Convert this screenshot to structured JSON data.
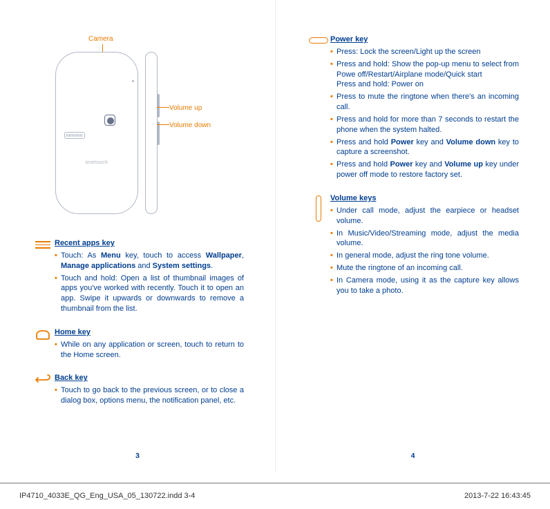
{
  "phone": {
    "brand": "onetouch",
    "camera_label": "Camera",
    "vol_up_label": "Volume up",
    "vol_down_label": "Volume down"
  },
  "recent": {
    "title": "Recent apps key",
    "item1_a": "Touch:  As ",
    "item1_b": "Menu",
    "item1_c": " key, touch to access ",
    "item1_d": "Wallpaper",
    "item1_e": ", ",
    "item1_f": "Manage applications",
    "item1_g": " and ",
    "item1_h": "System settings",
    "item1_i": ".",
    "item2": "Touch and hold: Open a list of thumbnail images of apps you've worked with recently. Touch it to open an app. Swipe it upwards or downwards to remove a thumbnail from the list."
  },
  "home": {
    "title": "Home key",
    "item1": "While on any application or screen,  touch to return to the Home screen."
  },
  "back": {
    "title": "Back key",
    "item1": "Touch to go back to the previous screen, or to close a dialog box, options menu, the notification panel, etc."
  },
  "power": {
    "title": "Power key",
    "item1": "Press: Lock the screen/Light up the screen",
    "item2": "Press and hold: Show the pop-up menu to select from Powe off/Restart/Airplane mode/Quick start\nPress and hold: Power on",
    "item3": "Press to mute the ringtone when there's an incoming call.",
    "item4": "Press and hold for more than 7 seconds to restart the phone when the system halted.",
    "item5_a": "Press and hold ",
    "item5_b": "Power",
    "item5_c": " key and ",
    "item5_d": "Volume down",
    "item5_e": " key to capture a screenshot.",
    "item6_a": "Press and hold ",
    "item6_b": "Power",
    "item6_c": " key and ",
    "item6_d": "Volume up",
    "item6_e": " key under power off mode to restore factory set."
  },
  "volume": {
    "title": "Volume keys",
    "item1": "Under call mode, adjust the earpiece or headset volume.",
    "item2": "In Music/Video/Streaming mode, adjust the media volume.",
    "item3": "In general mode, adjust the ring tone volume.",
    "item4": "Mute the ringtone of an incoming call.",
    "item5": "In Camera mode, using it as the capture key allows you to take a photo."
  },
  "pages": {
    "left": "3",
    "right": "4"
  },
  "footer": {
    "left": "IP4710_4033E_QG_Eng_USA_05_130722.indd   3-4",
    "right": "2013-7-22   16:43:45"
  }
}
